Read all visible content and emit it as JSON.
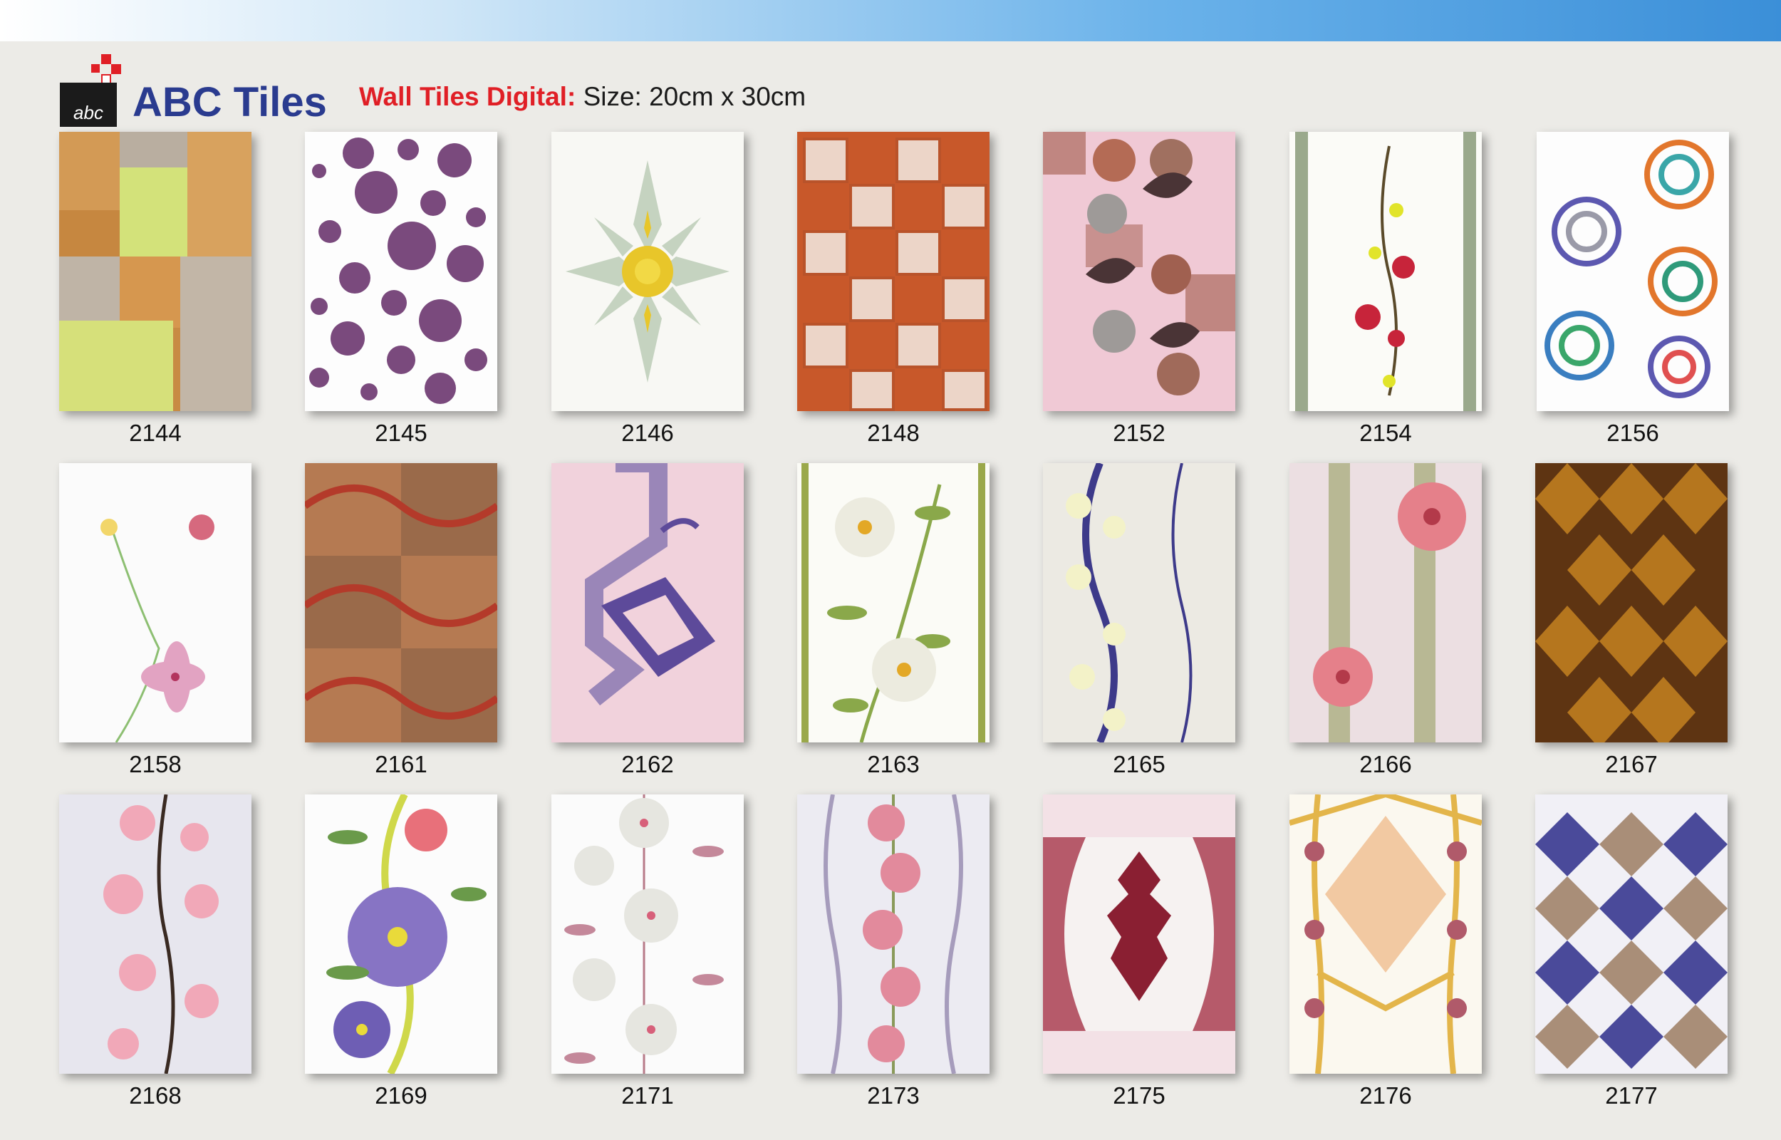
{
  "header": {
    "logo_text": "abc",
    "brand": "ABC Tiles",
    "category": "Wall Tiles Digital:",
    "size": "Size: 20cm x 30cm"
  },
  "colors": {
    "brand_blue": "#2a3b8f",
    "accent_red": "#e01f26"
  },
  "tiles": [
    {
      "code": "2144"
    },
    {
      "code": "2145"
    },
    {
      "code": "2146"
    },
    {
      "code": "2148"
    },
    {
      "code": "2152"
    },
    {
      "code": "2154"
    },
    {
      "code": "2156"
    },
    {
      "code": "2158"
    },
    {
      "code": "2161"
    },
    {
      "code": "2162"
    },
    {
      "code": "2163"
    },
    {
      "code": "2165"
    },
    {
      "code": "2166"
    },
    {
      "code": "2167"
    },
    {
      "code": "2168"
    },
    {
      "code": "2169"
    },
    {
      "code": "2171"
    },
    {
      "code": "2173"
    },
    {
      "code": "2175"
    },
    {
      "code": "2176"
    },
    {
      "code": "2177"
    }
  ]
}
